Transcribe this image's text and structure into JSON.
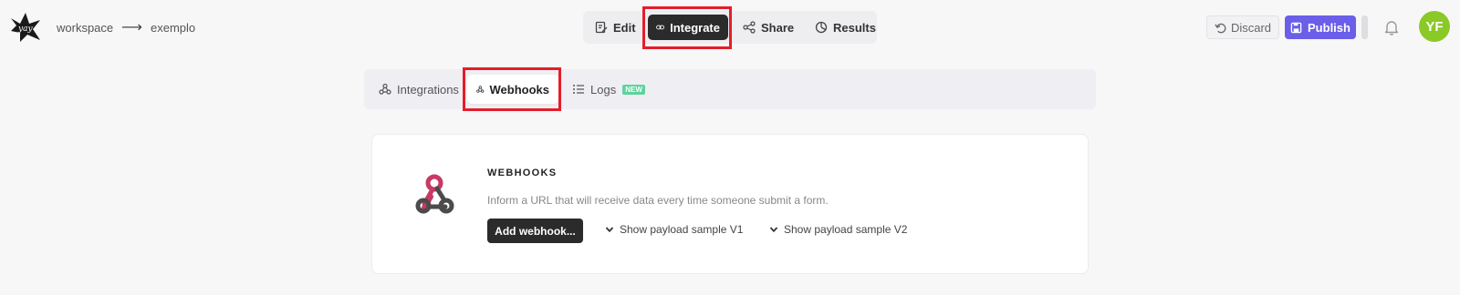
{
  "header": {
    "logo_icon": "yay-logo",
    "breadcrumb": {
      "workspace": "workspace",
      "separator": "⟶",
      "form": "exemplo"
    }
  },
  "topnav": {
    "tabs": [
      {
        "label": "Edit",
        "icon": "edit-icon"
      },
      {
        "label": "Integrate",
        "icon": "link-icon",
        "active": true
      },
      {
        "label": "Share",
        "icon": "share-icon"
      },
      {
        "label": "Results",
        "icon": "results-icon"
      }
    ]
  },
  "actions": {
    "discard": "Discard",
    "publish": "Publish",
    "avatar_initials": "YF"
  },
  "subtabs": {
    "items": [
      {
        "label": "Integrations",
        "icon": "integrations-icon"
      },
      {
        "label": "Webhooks",
        "icon": "webhook-icon",
        "active": true
      },
      {
        "label": "Logs",
        "icon": "list-icon",
        "badge": "NEW"
      }
    ]
  },
  "webhooks_card": {
    "title": "WEBHOOKS",
    "description": "Inform a URL that will receive data every time someone submit a form.",
    "add_button": "Add webhook...",
    "payload_v1": "Show payload sample V1",
    "payload_v2": "Show payload sample V2"
  },
  "colors": {
    "accent": "#6b5ee8",
    "highlight": "#e51d2a",
    "avatar": "#8ac926",
    "dark_button": "#2b2b2b",
    "new_badge": "#5dd39e"
  }
}
